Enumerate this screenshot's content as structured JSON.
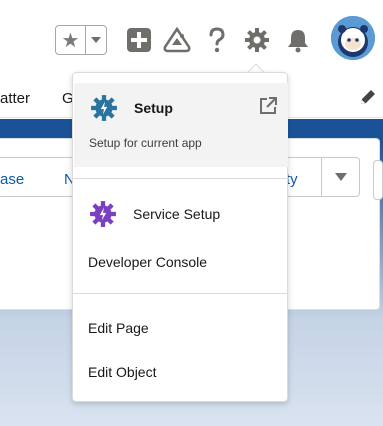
{
  "header": {
    "favorites_icon": "star-icon",
    "favorites_menu_icon": "chevron-down-icon",
    "add_icon": "plus-icon",
    "trailhead_icon": "trailhead-icon",
    "help_icon": "question-icon",
    "setup_icon": "gear-icon",
    "notifications_icon": "bell-icon",
    "avatar_icon": "astro-avatar"
  },
  "nav": {
    "items": [
      "atter",
      "G"
    ],
    "edit_icon": "pencil-icon"
  },
  "background_buttons": {
    "labels": [
      "ase",
      "N",
      "ty"
    ],
    "dropdown_icon": "chevron-down-icon"
  },
  "setup_menu": {
    "setup": {
      "label": "Setup",
      "subtitle": "Setup for current app",
      "icon": "gear-icon",
      "external_icon": "new-window-icon"
    },
    "service_setup": {
      "label": "Service Setup",
      "icon": "gear-icon"
    },
    "developer_console": {
      "label": "Developer Console"
    },
    "edit_page": {
      "label": "Edit Page"
    },
    "edit_object": {
      "label": "Edit Object"
    }
  },
  "colors": {
    "brand_blue": "#1b5297",
    "setup_gear": "#2a739e",
    "service_gear": "#7b3fc4",
    "link": "#0b5cab",
    "icon_gray": "#706e6b"
  }
}
